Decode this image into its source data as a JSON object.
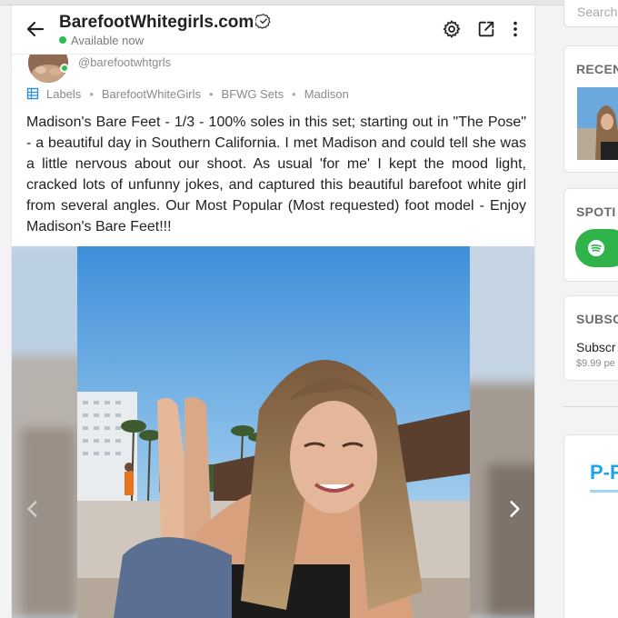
{
  "header": {
    "title": "BarefootWhitegirls.com",
    "status": "Available now"
  },
  "post": {
    "handle": "@barefootwhtgrls",
    "labels_title": "Labels",
    "labels": [
      "BarefootWhiteGirls",
      "BFWG Sets",
      "Madison"
    ],
    "separator": "•",
    "text": "Madison's Bare Feet - 1/3 - 100% soles in this set; starting out in \"The Pose\" - a beautiful day in Southern California. I met Madison and could tell she was a lit­tle nervous about our shoot. As usual 'for me' I kept the mood light, cracked lots of unfunny jokes, and captured this beautiful barefoot white girl from several an­gles. Our Most Popular (Most requested) foot model - Enjoy Madison's Bare Feet!!!"
  },
  "sidebar": {
    "search_placeholder": "Search",
    "recent_title": "RECEN",
    "spotify_title": "SPOTI",
    "subscribe_title": "SUBSC",
    "subscribe_text": "Subscr",
    "subscribe_price": "$9.99 pe",
    "promo_title": "P-P"
  },
  "colors": {
    "online": "#2dbf52",
    "accent": "#19a6e8",
    "spotify": "#2fb34a"
  },
  "icons": [
    "back-arrow-icon",
    "verified-badge-icon",
    "gear-icon",
    "share-icon",
    "more-vertical-icon",
    "label-icon",
    "chevron-left-icon",
    "chevron-right-icon",
    "spotify-icon"
  ]
}
